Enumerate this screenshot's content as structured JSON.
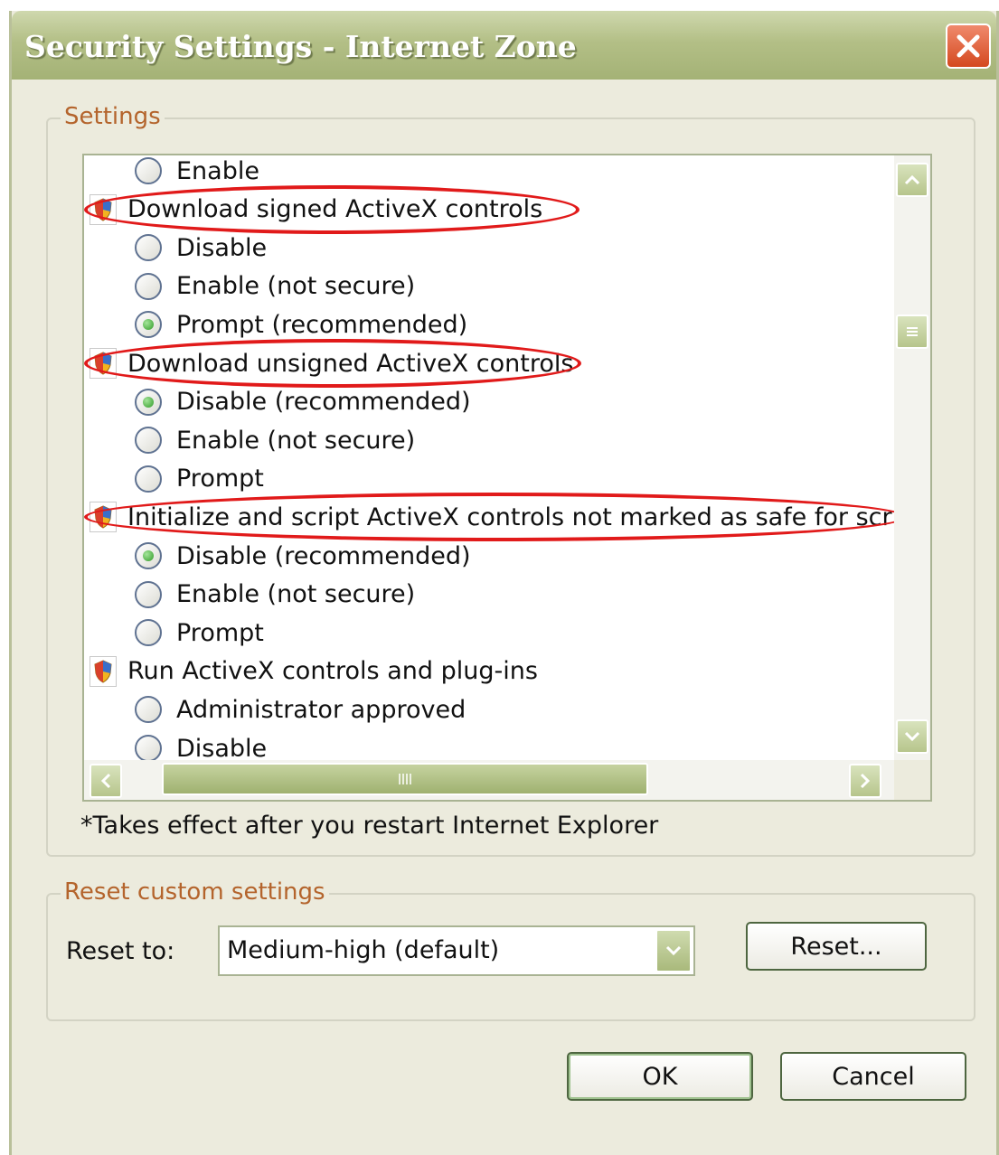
{
  "window": {
    "title": "Security Settings - Internet Zone",
    "close_icon": "close-icon"
  },
  "settings_group": {
    "label": "Settings",
    "items": [
      {
        "type": "radio",
        "label": "Enable",
        "checked": false
      },
      {
        "type": "header",
        "label": "Download signed ActiveX controls",
        "highlighted": true
      },
      {
        "type": "radio",
        "label": "Disable",
        "checked": false
      },
      {
        "type": "radio",
        "label": "Enable (not secure)",
        "checked": false
      },
      {
        "type": "radio",
        "label": "Prompt (recommended)",
        "checked": true
      },
      {
        "type": "header",
        "label": "Download unsigned ActiveX controls",
        "highlighted": true
      },
      {
        "type": "radio",
        "label": "Disable (recommended)",
        "checked": true
      },
      {
        "type": "radio",
        "label": "Enable (not secure)",
        "checked": false
      },
      {
        "type": "radio",
        "label": "Prompt",
        "checked": false
      },
      {
        "type": "header",
        "label": "Initialize and script ActiveX controls not marked as safe for scripti",
        "highlighted": true
      },
      {
        "type": "radio",
        "label": "Disable (recommended)",
        "checked": true
      },
      {
        "type": "radio",
        "label": "Enable (not secure)",
        "checked": false
      },
      {
        "type": "radio",
        "label": "Prompt",
        "checked": false
      },
      {
        "type": "header",
        "label": "Run ActiveX controls and plug-ins",
        "highlighted": false
      },
      {
        "type": "radio",
        "label": "Administrator approved",
        "checked": false
      },
      {
        "type": "radio",
        "label": "Disable",
        "checked": false
      }
    ],
    "note": "*Takes effect after you restart Internet Explorer"
  },
  "reset_group": {
    "label": "Reset custom settings",
    "reset_to_label": "Reset to:",
    "selected_level": "Medium-high (default)",
    "reset_button": "Reset..."
  },
  "buttons": {
    "ok": "OK",
    "cancel": "Cancel"
  },
  "colors": {
    "highlight_ellipse": "#e11a1a",
    "group_label": "#b4642c",
    "title_bar": "#b3bf86"
  }
}
